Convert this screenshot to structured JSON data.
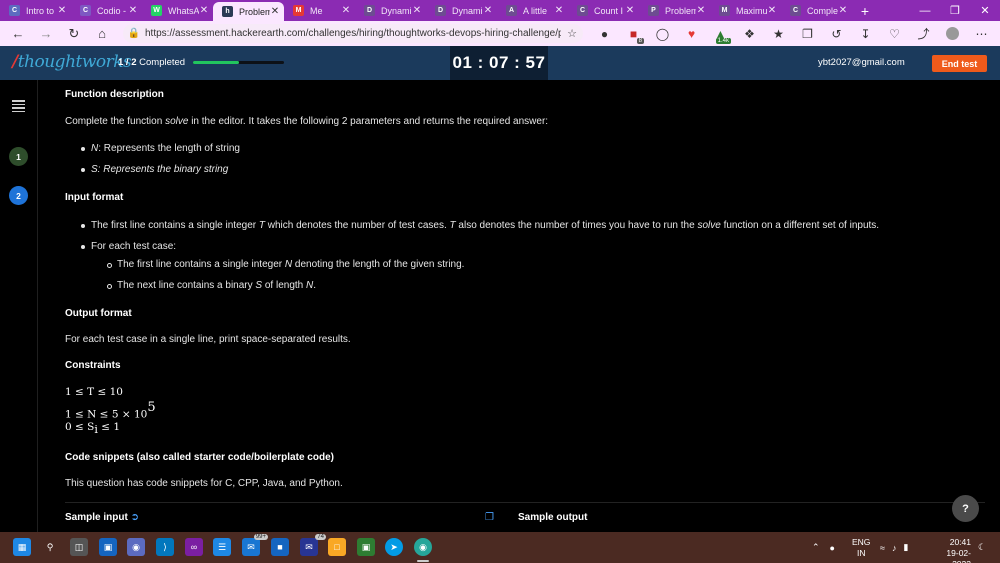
{
  "browser": {
    "tabs": [
      {
        "label": "Intro to",
        "icon": "C",
        "color": "#5c6bc0",
        "active": false
      },
      {
        "label": "Codio -",
        "icon": "C",
        "color": "#7e57c2",
        "active": false
      },
      {
        "label": "WhatsA",
        "icon": "W",
        "color": "#25d366",
        "active": false
      },
      {
        "label": "Problem",
        "icon": "h",
        "color": "#2b3a55",
        "active": true
      },
      {
        "label": "Me",
        "icon": "M",
        "color": "#e53935",
        "active": false
      },
      {
        "label": "Dynami",
        "icon": "D",
        "color": "#6d4c91",
        "active": false
      },
      {
        "label": "Dynami",
        "icon": "D",
        "color": "#6d4c91",
        "active": false
      },
      {
        "label": "A little",
        "icon": "A",
        "color": "#6d4c91",
        "active": false
      },
      {
        "label": "Count I",
        "icon": "C",
        "color": "#6d4c91",
        "active": false
      },
      {
        "label": "Problem",
        "icon": "P",
        "color": "#6d4c91",
        "active": false
      },
      {
        "label": "Maximu",
        "icon": "M",
        "color": "#6d4c91",
        "active": false
      },
      {
        "label": "Comple",
        "icon": "C",
        "color": "#6d4c91",
        "active": false
      }
    ],
    "url": "https://assessment.hackerearth.com/challenges/hiring/thoughtworks-devops-hiring-challenge/pro...",
    "ext_badges": {
      "shield": "8",
      "leaf": "1.4k"
    }
  },
  "header": {
    "logo": "thoughtworks",
    "progress_count": "1 / 2",
    "progress_label": "Completed",
    "progress_fraction": 0.5,
    "timer": "01 : 07 : 57",
    "email": "ybt2027@gmail.com",
    "end_test": "End test"
  },
  "rail": {
    "questions": [
      {
        "num": "1",
        "color": "#2e4d2b"
      },
      {
        "num": "2",
        "color": "#1e73d8"
      }
    ]
  },
  "problem": {
    "function_desc_heading": "Function description",
    "function_desc_pre": "Complete the function ",
    "function_name": "solve",
    "function_desc_post": " in the editor. It takes the following 2 parameters and returns the required answer:",
    "params": [
      {
        "name": "N",
        "desc": ": Represents the length of string"
      },
      {
        "name": "S",
        "desc": ": Represents the binary string"
      }
    ],
    "input_heading": "Input format",
    "input_line1_a": "The first line contains a single integer ",
    "input_line1_var": "T",
    "input_line1_b": " which denotes the number of test cases. ",
    "input_line1_var2": "T",
    "input_line1_c": " also denotes the number of times you have to run the ",
    "input_line1_fn": "solve",
    "input_line1_d": " function on a different set of inputs.",
    "input_line2": "For each test case:",
    "input_sub1_a": "The first line contains a single integer ",
    "input_sub1_var": "N",
    "input_sub1_b": " denoting the length of the given string.",
    "input_sub2_a": "The next line contains a binary ",
    "input_sub2_var": "S",
    "input_sub2_b": " of length ",
    "input_sub2_var2": "N",
    "input_sub2_c": ".",
    "output_heading": "Output format",
    "output_text": "For each test case in a single line, print space-separated results.",
    "constraints_heading": "Constraints",
    "constraint1": "1 ≤ T ≤ 10",
    "constraint2_a": "1 ≤ N ≤ 5 × 10",
    "constraint2_exp": "5",
    "constraint3_a": "0 ≤ S",
    "constraint3_sub": "i",
    "constraint3_b": " ≤ 1",
    "snippets_heading": "Code snippets (also called starter code/boilerplate code)",
    "snippets_text": "This question has code snippets for C, CPP, Java, and Python.",
    "sample_input": "Sample input",
    "sample_output": "Sample output"
  },
  "help_label": "?",
  "taskbar": {
    "lang": "ENG",
    "region": "IN",
    "time": "20:41",
    "date": "19-02-2022",
    "mail_badge": "99+",
    "app_badge": "74"
  }
}
